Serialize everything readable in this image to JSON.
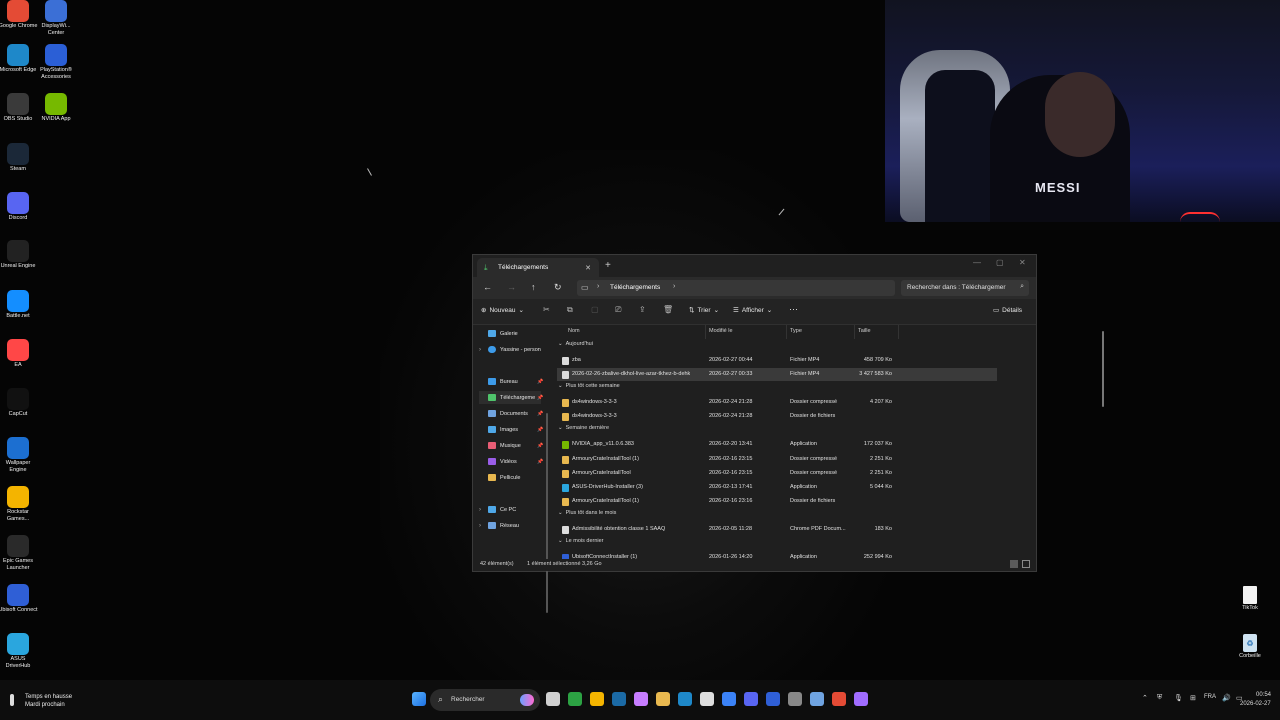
{
  "desktop": {
    "icons_left": [
      {
        "label": "Google Chrome",
        "icon": "chrome-icon",
        "color": "#e44b35"
      },
      {
        "label": "Microsoft Edge",
        "icon": "edge-icon",
        "color": "#1e88c9"
      },
      {
        "label": "OBS Studio",
        "icon": "obs-icon",
        "color": "#3a3a3a"
      },
      {
        "label": "Steam",
        "icon": "steam-icon",
        "color": "#1b2838"
      },
      {
        "label": "Discord",
        "icon": "discord-icon",
        "color": "#5865f2"
      },
      {
        "label": "Unreal Engine",
        "icon": "unreal-icon",
        "color": "#222222"
      },
      {
        "label": "Battle.net",
        "icon": "battlenet-icon",
        "color": "#148eff"
      },
      {
        "label": "EA",
        "icon": "ea-icon",
        "color": "#ff4747"
      },
      {
        "label": "CapCut",
        "icon": "capcut-icon",
        "color": "#111111"
      },
      {
        "label": "Wallpaper Engine",
        "icon": "wallpaper-engine-icon",
        "color": "#1c6fd1"
      },
      {
        "label": "Rockstar Games...",
        "icon": "rockstar-icon",
        "color": "#f4b400"
      },
      {
        "label": "Epic Games Launcher",
        "icon": "epic-games-icon",
        "color": "#2a2a2a"
      },
      {
        "label": "Ubisoft Connect",
        "icon": "ubisoft-icon",
        "color": "#2f5fd6"
      },
      {
        "label": "ASUS DriverHub",
        "icon": "asus-icon",
        "color": "#2aa6de"
      }
    ],
    "icons_col2": [
      {
        "label": "DisplayWi... Center",
        "icon": "display-icon",
        "color": "#3b6fd6"
      },
      {
        "label": "PlayStation® Accessories",
        "icon": "playstation-icon",
        "color": "#2b5fd6"
      },
      {
        "label": "NVIDIA App",
        "icon": "nvidia-icon",
        "color": "#76b900"
      }
    ],
    "icons_right": [
      {
        "label": "TikTok",
        "icon": "file-icon"
      },
      {
        "label": "Corbeille",
        "icon": "recycle-bin-icon"
      }
    ]
  },
  "webcam": {
    "shirt_text": "MESSI"
  },
  "explorer": {
    "tab_title": "Téléchargements",
    "breadcrumb": "Téléchargements",
    "search_placeholder": "Rechercher dans : Téléchargemer",
    "toolbar": {
      "new": "Nouveau",
      "sort": "Trier",
      "view": "Afficher",
      "more": "···",
      "details": "Détails"
    },
    "nav": {
      "galerie": "Galerie",
      "onedrive": "Yassine - person",
      "quick": [
        {
          "label": "Bureau",
          "color": "#3d9be9"
        },
        {
          "label": "Téléchargeme",
          "color": "#4fc36b"
        },
        {
          "label": "Documents",
          "color": "#6fa3e0"
        },
        {
          "label": "Images",
          "color": "#4fa8e8"
        },
        {
          "label": "Musique",
          "color": "#e85d75"
        },
        {
          "label": "Vidéos",
          "color": "#9a5de8"
        },
        {
          "label": "Pellicule",
          "color": "#e8b84f"
        }
      ],
      "this_pc": "Ce PC",
      "network": "Réseau"
    },
    "columns": {
      "name": "Nom",
      "modified": "Modifié le",
      "type": "Type",
      "size": "Taille"
    },
    "groups": [
      {
        "label": "Aujourd'hui",
        "rows": [
          {
            "name": "zba",
            "date": "2026-02-27 00:44",
            "type": "Fichier MP4",
            "size": "458 709 Ko",
            "color": "#dcdcdc",
            "selected": false
          },
          {
            "name": "2026-02-26-zbalive-dkhol-live-azar-tkhez-b-dehk",
            "date": "2026-02-27 00:33",
            "type": "Fichier MP4",
            "size": "3 427 583 Ko",
            "color": "#dcdcdc",
            "selected": true
          }
        ]
      },
      {
        "label": "Plus tôt cette semaine",
        "rows": [
          {
            "name": "ds4windows-3-3-3",
            "date": "2026-02-24 21:28",
            "type": "Dossier compressé",
            "size": "4 207 Ko",
            "color": "#e8b84f",
            "selected": false
          },
          {
            "name": "ds4windows-3-3-3",
            "date": "2026-02-24 21:28",
            "type": "Dossier de fichiers",
            "size": "",
            "color": "#e8b84f",
            "selected": false
          }
        ]
      },
      {
        "label": "Semaine dernière",
        "rows": [
          {
            "name": "NVIDIA_app_v11.0.6.383",
            "date": "2026-02-20 13:41",
            "type": "Application",
            "size": "172 037 Ko",
            "color": "#76b900",
            "selected": false
          },
          {
            "name": "ArmouryCrateInstallTool (1)",
            "date": "2026-02-16 23:15",
            "type": "Dossier compressé",
            "size": "2 251 Ko",
            "color": "#e8b84f",
            "selected": false
          },
          {
            "name": "ArmouryCrateInstallTool",
            "date": "2026-02-16 23:15",
            "type": "Dossier compressé",
            "size": "2 251 Ko",
            "color": "#e8b84f",
            "selected": false
          },
          {
            "name": "ASUS-DriverHub-Installer (3)",
            "date": "2026-02-13 17:41",
            "type": "Application",
            "size": "5 044 Ko",
            "color": "#2aa6de",
            "selected": false
          },
          {
            "name": "ArmouryCrateInstallTool (1)",
            "date": "2026-02-16 23:16",
            "type": "Dossier de fichiers",
            "size": "",
            "color": "#e8b84f",
            "selected": false
          }
        ]
      },
      {
        "label": "Plus tôt dans le mois",
        "rows": [
          {
            "name": "Admissibilité obtention classe 1 SAAQ",
            "date": "2026-02-05 11:28",
            "type": "Chrome PDF Docum...",
            "size": "183 Ko",
            "color": "#dcdcdc",
            "selected": false
          }
        ]
      },
      {
        "label": "Le mois dernier",
        "rows": [
          {
            "name": "UbisoftConnectInstaller (1)",
            "date": "2026-01-26 14:20",
            "type": "Application",
            "size": "252 994 Ko",
            "color": "#2f5fd6",
            "selected": false
          }
        ]
      }
    ],
    "status": {
      "count": "42 élément(s)",
      "selection": "1 élément sélectionné  3,26 Go"
    }
  },
  "taskbar": {
    "weather_title": "Temps en hausse",
    "weather_sub": "Mardi prochain",
    "search": "Rechercher",
    "lang": "FRA",
    "time": "00:54",
    "date": "2026-02-27",
    "pinned": [
      {
        "icon": "task-view-icon",
        "color": "#cfcfcf"
      },
      {
        "icon": "xbox-icon",
        "color": "#2ca243"
      },
      {
        "icon": "rockstar-icon",
        "color": "#f4b400"
      },
      {
        "icon": "steam-icon",
        "color": "#1b6aa5"
      },
      {
        "icon": "copilot-icon",
        "color": "#c77dff"
      },
      {
        "icon": "file-explorer-icon",
        "color": "#e8b84f"
      },
      {
        "icon": "edge-icon",
        "color": "#1e88c9"
      },
      {
        "icon": "store-icon",
        "color": "#dddddd"
      },
      {
        "icon": "mail-icon",
        "color": "#3b82f6"
      },
      {
        "icon": "discord-icon",
        "color": "#5865f2"
      },
      {
        "icon": "ubisoft-icon",
        "color": "#2f5fd6"
      },
      {
        "icon": "obs-icon",
        "color": "#888888"
      },
      {
        "icon": "displaywidget-icon",
        "color": "#6fa3e0"
      },
      {
        "icon": "chrome-icon",
        "color": "#e44b35"
      },
      {
        "icon": "game-controller-icon",
        "color": "#a06cff"
      }
    ]
  }
}
